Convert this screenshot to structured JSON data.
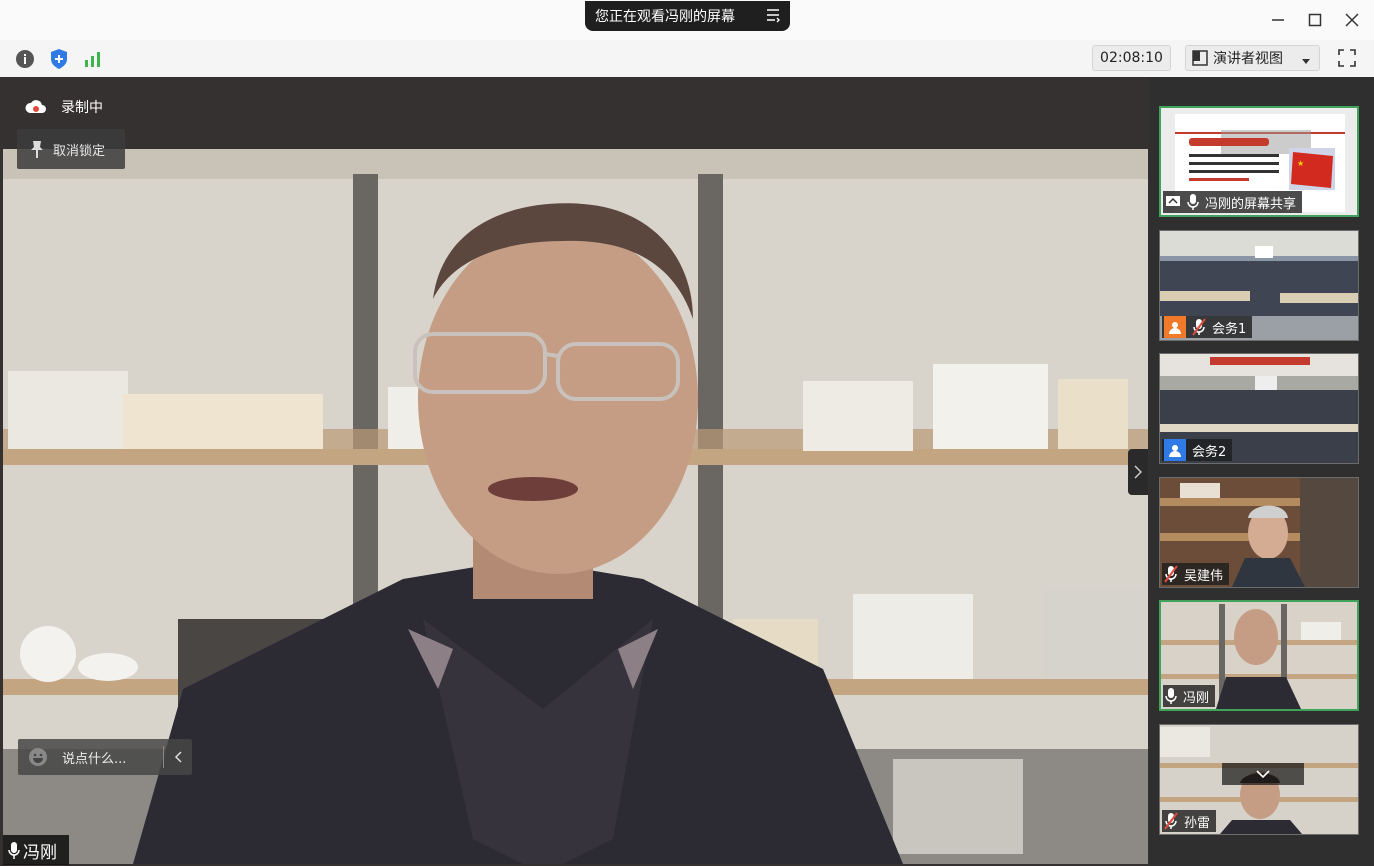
{
  "window": {
    "banner_text": "您正在观看冯刚的屏幕"
  },
  "toolbar": {
    "timer": "02:08:10",
    "view_mode": "演讲者视图"
  },
  "main": {
    "recording_label": "录制中",
    "unlock_label": "取消锁定",
    "chat_placeholder": "说点什么...",
    "speaker_name": "冯刚"
  },
  "participants": [
    {
      "name": "冯刚的屏幕共享",
      "type": "screen-share",
      "slide_text": "主题教育学习材料 国旗"
    },
    {
      "name": "会务1",
      "type": "room",
      "avatar_color": "#f07a2a"
    },
    {
      "name": "会务2",
      "type": "room",
      "avatar_color": "#2f7ae5"
    },
    {
      "name": "吴建伟",
      "type": "person"
    },
    {
      "name": "冯刚",
      "type": "person"
    },
    {
      "name": "孙雷",
      "type": "person"
    }
  ],
  "colors": {
    "active_border": "#3fa35a",
    "recording_icon": "#e04a3c",
    "shield": "#2f7ae5",
    "signal": "#3cb54a"
  }
}
